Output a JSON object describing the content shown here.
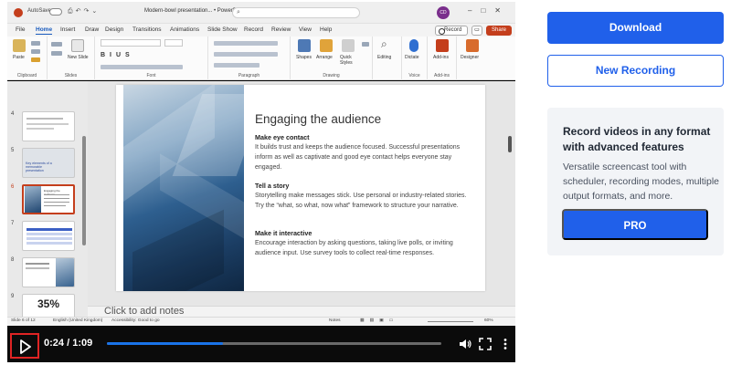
{
  "player": {
    "time_current": "0:24",
    "time_separator": " / ",
    "time_total": "1:09",
    "progress": 0.347,
    "icons": [
      "play-icon",
      "volume-icon",
      "fullscreen-icon",
      "more-options-icon"
    ]
  },
  "powerpoint": {
    "autosave_label": "AutoSave",
    "doc_title": "Modern-bowl presentation... • PowerPoint",
    "search_placeholder": "Search",
    "user_initials": "CD",
    "menus": [
      "File",
      "Home",
      "Insert",
      "Draw",
      "Design",
      "Transitions",
      "Animations",
      "Slide Show",
      "Record",
      "Review",
      "View",
      "Help"
    ],
    "active_menu": "Home",
    "record_label": "Record",
    "share_label": "Share",
    "ribbon": {
      "paste": "Paste",
      "new_slide": "New Slide",
      "shapes": "Shapes",
      "arrange": "Arrange",
      "quick_styles": "Quick Styles",
      "editing": "Editing",
      "dictate": "Dictate",
      "addins": "Add-ins",
      "designer": "Designer",
      "groups": {
        "clipboard": "Clipboard",
        "slides": "Slides",
        "font": "Font",
        "paragraph": "Paragraph",
        "drawing": "Drawing",
        "voice": "Voice",
        "addins": "Add-ins"
      }
    },
    "thumbnails": [
      {
        "num": "4",
        "caption": ""
      },
      {
        "num": "5",
        "caption": "Key elements of a memorable presentation"
      },
      {
        "num": "6",
        "caption": "Engaging the audience"
      },
      {
        "num": "7",
        "caption": ""
      },
      {
        "num": "8",
        "caption": ""
      },
      {
        "num": "9",
        "caption": "35%"
      }
    ],
    "selected_thumbnail": "6",
    "slide": {
      "title": "Engaging the audience",
      "sections": [
        {
          "heading": "Make eye contact",
          "body": "It builds trust and keeps the audience focused. Successful presentations inform as well as captivate and good eye contact helps everyone stay engaged."
        },
        {
          "heading": "Tell a story",
          "body": "Storytelling make messages stick. Use personal or industry-related stories. Try the “what, so what, now what” framework to structure your narrative."
        },
        {
          "heading": "Make it interactive",
          "body": "Encourage interaction by asking questions, taking live polls, or inviting audience input. Use survey tools to collect real-time responses."
        }
      ]
    },
    "notes_placeholder": "Click to add notes",
    "status": {
      "slide_of": "Slide 6 of 12",
      "language": "English (United Kingdom)",
      "accessibility": "Accessibility: Good to go",
      "notes": "Notes",
      "zoom": "60%"
    }
  },
  "sidebar": {
    "download_label": "Download",
    "new_recording_label": "New Recording",
    "promo": {
      "title": "Record videos in any format with advanced features",
      "description": "Versatile screencast tool with scheduler, recording modes, multiple output formats, and more.",
      "pro_label": "PRO"
    }
  },
  "colors": {
    "accent": "#2060ea",
    "ppt_brand": "#c43e1c",
    "player_bg": "#0b0b0b",
    "seek_fill": "#1a73e8",
    "play_highlight": "#e02424"
  }
}
